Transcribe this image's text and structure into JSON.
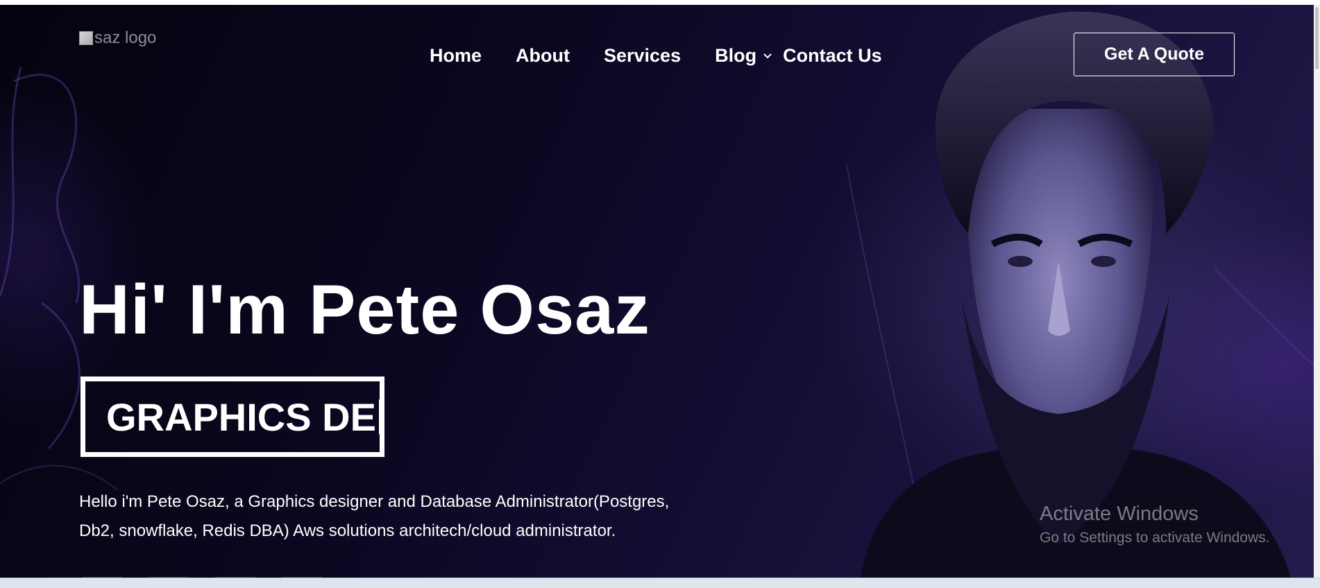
{
  "logo": {
    "alt_text": "saz logo"
  },
  "nav": {
    "items": [
      {
        "label": "Home"
      },
      {
        "label": "About"
      },
      {
        "label": "Services"
      },
      {
        "label": "Blog"
      },
      {
        "label": "Contact Us"
      }
    ],
    "blog_dropdown_icon": "chevron-down-icon"
  },
  "cta": {
    "label": "Get A Quote"
  },
  "hero": {
    "title": "Hi' I'm Pete Osaz",
    "typed_text": "GRAPHICS DE",
    "bio": "Hello i'm Pete Osaz, a Graphics designer and Database Administrator(Postgres, Db2, snowflake, Redis DBA) Aws solutions architech/cloud administrator."
  },
  "watermark": {
    "title": "Activate Windows",
    "subtitle": "Go to Settings to activate Windows."
  },
  "colors": {
    "background": "#0b0720",
    "accent_purple": "#241b4c",
    "text": "#ffffff"
  }
}
